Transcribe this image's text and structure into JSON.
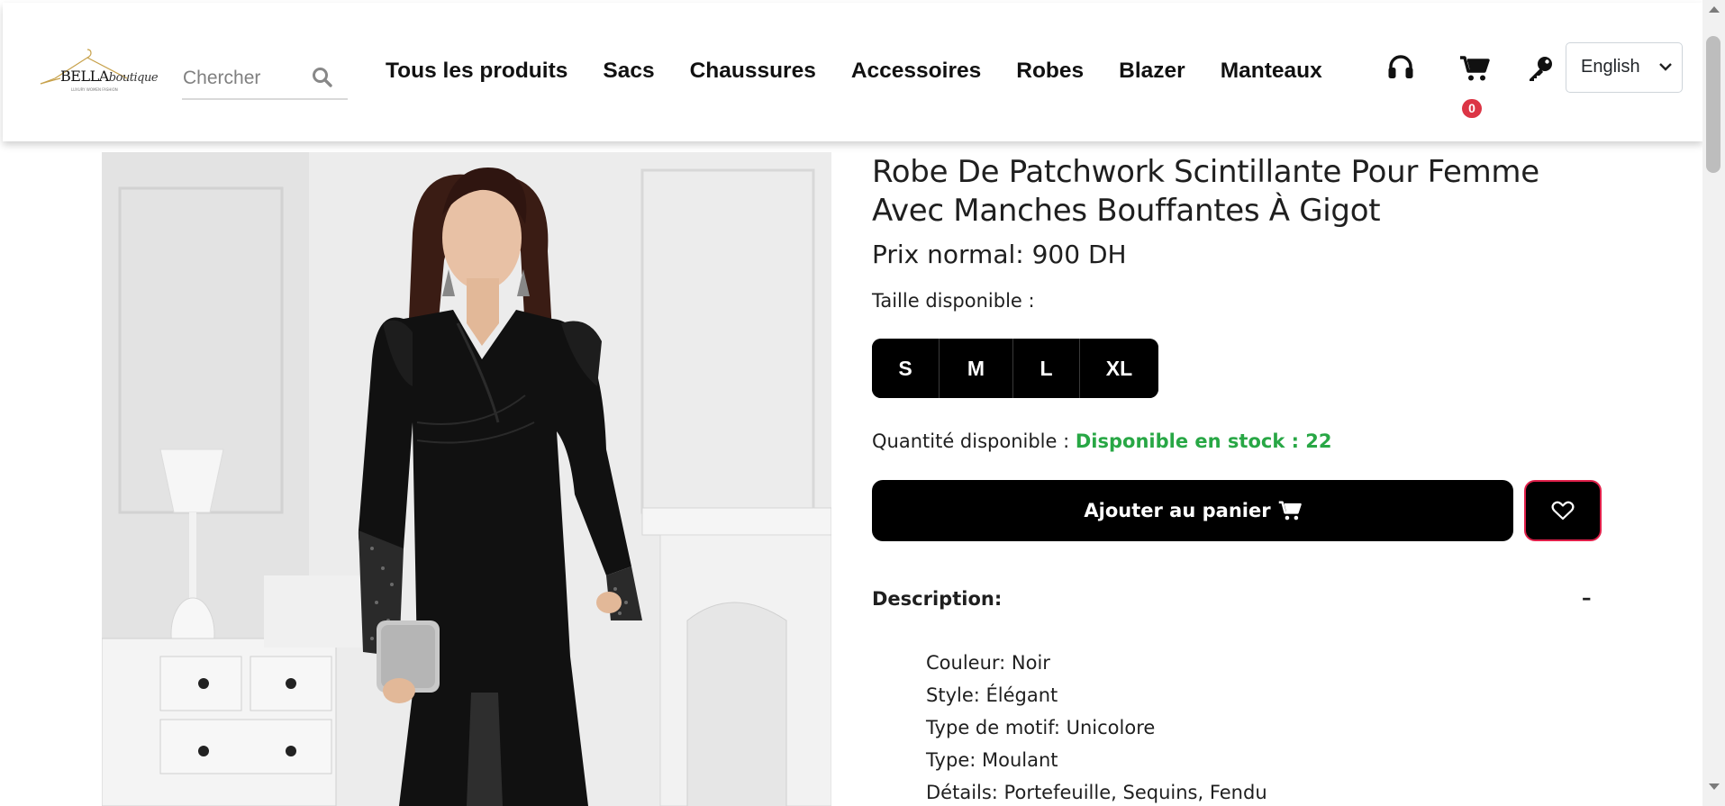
{
  "header": {
    "logo": {
      "brand": "BELLA",
      "script": "boutique",
      "tagline": "LUXURY WOMEN FASHION"
    },
    "search": {
      "placeholder": "Chercher"
    },
    "nav": [
      "Tous les produits",
      "Sacs",
      "Chaussures",
      "Accessoires",
      "Robes",
      "Blazer",
      "Manteaux"
    ],
    "icons": {
      "support": "headset-icon",
      "cart": "shopping-cart-icon",
      "login": "key-icon"
    },
    "cart_count": "0",
    "language": {
      "selected": "English"
    }
  },
  "product": {
    "image": {
      "alt": "Robe noire"
    },
    "title": "Robe De Patchwork Scintillante Pour Femme Avec Manches Bouffantes À Gigot",
    "price": "Prix normal: 900 DH",
    "sizes_label": "Taille disponible :",
    "sizes": [
      "S",
      "M",
      "L",
      "XL"
    ],
    "qty_label": "Quantité disponible :",
    "qty_value": "Disponible en stock : 22",
    "add_to_cart": "Ajouter au panier",
    "wishlist_icon": "heart-icon",
    "description": {
      "title": "Description:",
      "toggle": "–",
      "items": [
        "Couleur: Noir",
        "Style: Élégant",
        "Type de motif: Unicolore",
        "Type: Moulant",
        "Détails: Portefeuille, Sequins, Fendu"
      ]
    }
  },
  "colors": {
    "accent": "#000000",
    "stock_green": "#28a745",
    "badge_red": "#dc3545",
    "wishlist_border": "#e0204a"
  }
}
